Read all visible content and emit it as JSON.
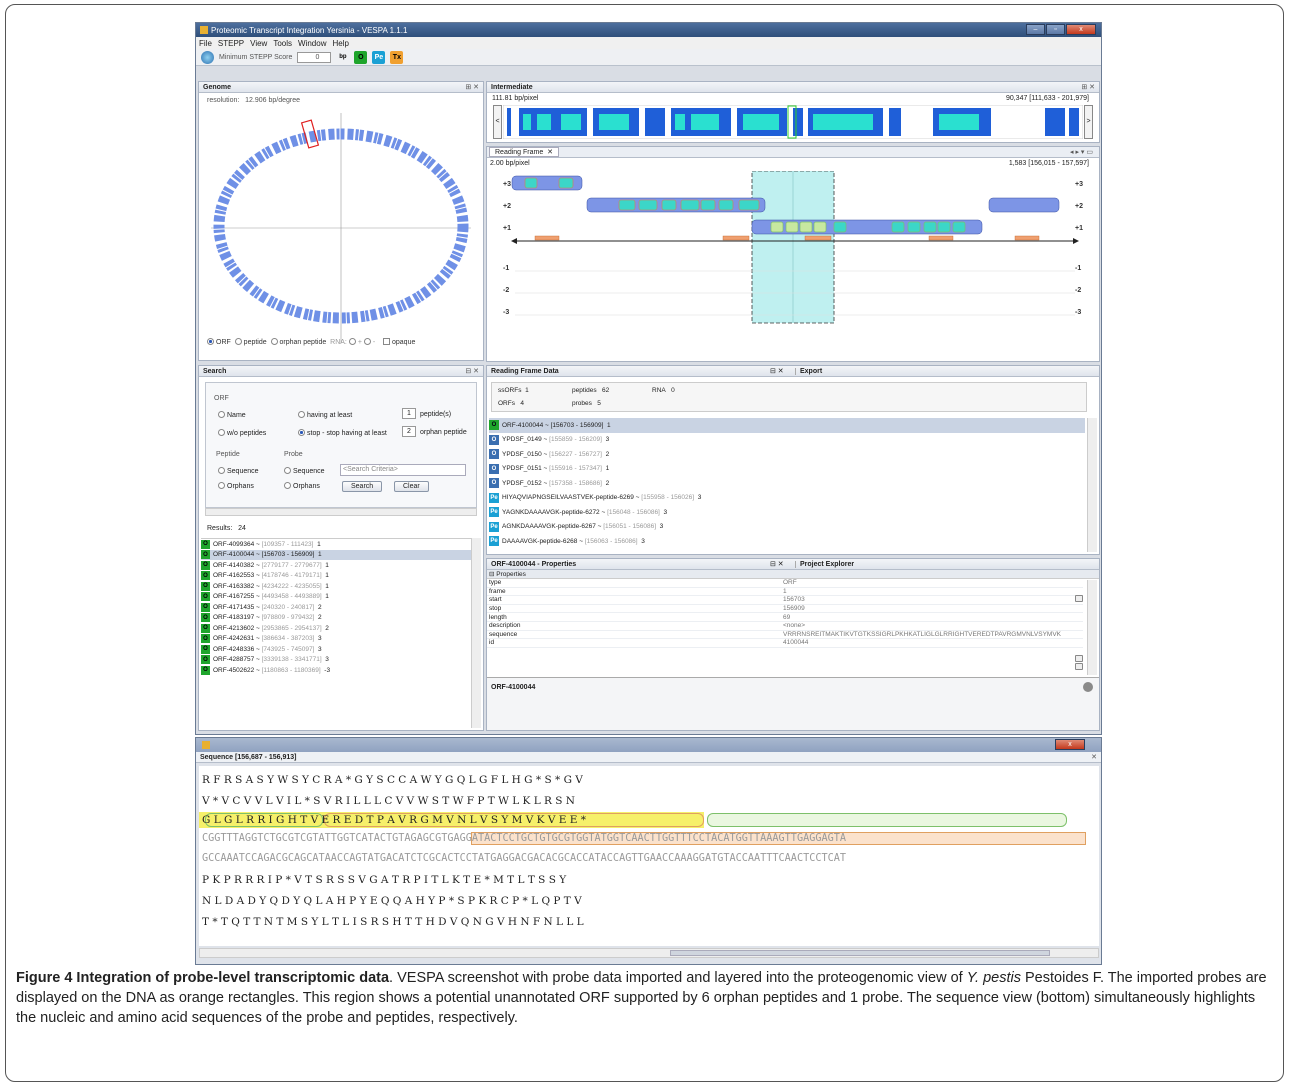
{
  "app": {
    "title": "Proteomic Transcript Integration Yersinia - VESPA 1.1.1",
    "menu": [
      "File",
      "STEPP",
      "View",
      "Tools",
      "Window",
      "Help"
    ],
    "toolbar": {
      "min_score_label": "Minimum STEPP Score",
      "min_score_value": "0",
      "bp_icon": "bp",
      "icons": [
        "O",
        "Pe",
        "Tx"
      ]
    },
    "window_buttons": [
      "–",
      "▫",
      "x"
    ]
  },
  "genome": {
    "title": "Genome",
    "resolution_label": "resolution:",
    "resolution_value": "12.906 bp/degree",
    "options": [
      "ORF",
      "peptide",
      "orphan peptide",
      "RNA:",
      "+",
      "-",
      "opaque"
    ]
  },
  "intermediate": {
    "title": "Intermediate",
    "left": "111.81 bp/pixel",
    "right": "90,347 [111,633 - 201,979]"
  },
  "reading_frame": {
    "tab": "Reading Frame",
    "left": "2.00 bp/pixel",
    "right": "1,583 [156,015 - 157,597]",
    "frames": [
      "+3",
      "+2",
      "+1",
      "-1",
      "-2",
      "-3"
    ]
  },
  "search": {
    "title": "Search",
    "group": "ORF",
    "name": "Name",
    "wo": "w/o peptides",
    "having": "having at least",
    "having_val": "1",
    "peptides": "peptide(s)",
    "stop": "stop - stop having at least",
    "stop_val": "2",
    "orphan": "orphan peptide",
    "peptide": "Peptide",
    "probe": "Probe",
    "sequence": "Sequence",
    "orphans": "Orphans",
    "criteria": "<Search Criteria>",
    "btn_search": "Search",
    "btn_clear": "Clear",
    "results_label": "Results:",
    "results_count": "24",
    "results": [
      {
        "n": "ORF-4099364",
        "r": "[109357 - 111423]",
        "c": "1"
      },
      {
        "n": "ORF-4100044",
        "r": "[156703 - 156909]",
        "c": "1"
      },
      {
        "n": "ORF-4140382",
        "r": "[2779177 - 2779677]",
        "c": "1"
      },
      {
        "n": "ORF-4162553",
        "r": "[4178746 - 4179171]",
        "c": "1"
      },
      {
        "n": "ORF-4163382",
        "r": "[4234222 - 4235055]",
        "c": "1"
      },
      {
        "n": "ORF-4167255",
        "r": "[4493458 - 4493889]",
        "c": "1"
      },
      {
        "n": "ORF-4171435",
        "r": "[240320 - 240817]",
        "c": "2"
      },
      {
        "n": "ORF-4183197",
        "r": "[978809 - 979432]",
        "c": "2"
      },
      {
        "n": "ORF-4213602",
        "r": "[2953865 - 2954137]",
        "c": "2"
      },
      {
        "n": "ORF-4242631",
        "r": "[386634 - 387203]",
        "c": "3"
      },
      {
        "n": "ORF-4248336",
        "r": "[743925 - 745097]",
        "c": "3"
      },
      {
        "n": "ORF-4288757",
        "r": "[3339138 - 3341771]",
        "c": "3"
      },
      {
        "n": "ORF-4502622",
        "r": "[1180863 - 1180369]",
        "c": "-3"
      }
    ]
  },
  "rfdata": {
    "title": "Reading Frame Data",
    "export": "Export",
    "stats": [
      [
        "ssORFs",
        "1"
      ],
      [
        "peptides",
        "62"
      ],
      [
        "RNA",
        "0"
      ],
      [
        "ORFs",
        "4"
      ],
      [
        "probes",
        "5"
      ]
    ],
    "items": [
      {
        "i": "orf",
        "n": "ORF-4100044",
        "r": "[156703 - 156909]",
        "c": "1"
      },
      {
        "i": "ysf",
        "n": "YPDSF_0149",
        "r": "[155859 - 156209]",
        "c": "3"
      },
      {
        "i": "ysf",
        "n": "YPDSF_0150",
        "r": "[156227 - 156727]",
        "c": "2"
      },
      {
        "i": "ysf",
        "n": "YPDSF_0151",
        "r": "[155916 - 157347]",
        "c": "1"
      },
      {
        "i": "ysf",
        "n": "YPDSF_0152",
        "r": "[157358 - 158686]",
        "c": "2"
      },
      {
        "i": "pep",
        "n": "HIYAQVIAPNGSEILVAASTVEK-peptide-6269",
        "r": "[155958 - 156026]",
        "c": "3"
      },
      {
        "i": "pep",
        "n": "YAGNKDAAAAVGK-peptide-6272",
        "r": "[156048 - 156086]",
        "c": "3"
      },
      {
        "i": "pep",
        "n": "AGNKDAAAAVGK-peptide-6267",
        "r": "[156051 - 156086]",
        "c": "3"
      },
      {
        "i": "pep",
        "n": "DAAAAVGK-peptide-6268",
        "r": "[156063 - 156086]",
        "c": "3"
      }
    ]
  },
  "props": {
    "title": "ORF-4100044 - Properties",
    "explorer": "Project Explorer",
    "section": "Properties",
    "rows": [
      [
        "type",
        "ORF"
      ],
      [
        "frame",
        "1"
      ],
      [
        "start",
        "156703"
      ],
      [
        "stop",
        "156909"
      ],
      [
        "length",
        "69"
      ],
      [
        "description",
        "<none>"
      ],
      [
        "sequence",
        "VRRRNSREITMAKTIKVTGTKSSIGRLPKHKATLIGLGLRRIGHTVEREDTPAVRGMVNLVSYMVK"
      ],
      [
        "id",
        "4100044"
      ]
    ],
    "footer": "ORF-4100044"
  },
  "sequence": {
    "title": "Sequence [156,687 - 156,913]",
    "lines": [
      "R  F  R  S  A  S  Y  W  S  Y  C  R  A  *  G  Y  S  C  C  A  W  Y  G  Q  L  G  F  L  H  G  *  S  *  G  V",
      "  V  *  V  C  V  V  L  V  I  L  *  S  V  R  I  L  L  L  C  V  V  W  S  T  W  F  P  T  W  L  K  L  R  S  N",
      " G  L  G  L  R  R  I  G  H  T  V  E  R  E  D  T  P  A  V  R  G  M  V  N  L  V  S  Y  M  V  K  V  E  E  *",
      "CGGTTTAGGTCTGCGTCGTATTGGTCATACTGTAGAGCGTGAGGATACTCCTGCTGTGCGTGGTATGGTCAACTTGGTTTCCTACATGGTTAAAGTTGAGGAGTA",
      "GCCAAATCCAGACGCAGCATAACCAGTATGACATCTCGCACTCCTATGAGGACGACACGCACCATACCAGTTGAACCAAAGGATGTACCAATTTCAACTCCTCAT",
      "P  K  P  R  R  R  I  P  *  V  T  S  R  S  S  V  G  A  T  R  P  I  T  L  K  T  E  *  M  T  L  T  S  S  Y",
      "  N  L  D  A  D  Y  Q  D  Y  Q  L  A  H  P  Y  E  Q  Q  A  H  Y  P  *  S  P  K  R  C  P  *  L  Q  P  T  V",
      "T  *  T  Q  T  T  N  T  M  S  Y  L  T  L  I  S  R  S  H  T  T  H  D  V  Q  N  G  V  H  N  F  N  L  L  L"
    ]
  },
  "caption": {
    "bold": "Figure 4 Integration of probe-level transcriptomic data",
    "text": ". VESPA screenshot with probe data imported and layered into the proteogenomic view of ",
    "species": "Y. pestis",
    "text2": " Pestoides F. The imported probes are displayed on the DNA as orange rectangles. This region shows a potential unannotated ORF supported by 6 orphan peptides and 1 probe. The sequence view (bottom) simultaneously highlights the nucleic and amino acid sequences of the probe and peptides, respectively."
  },
  "colors": {
    "orf": "#1fa52c",
    "pep": "#1aa0d4",
    "probe": "#f0a070",
    "peptide_fill": "#3cd6c8",
    "orfbar": "#6f8fe0"
  }
}
